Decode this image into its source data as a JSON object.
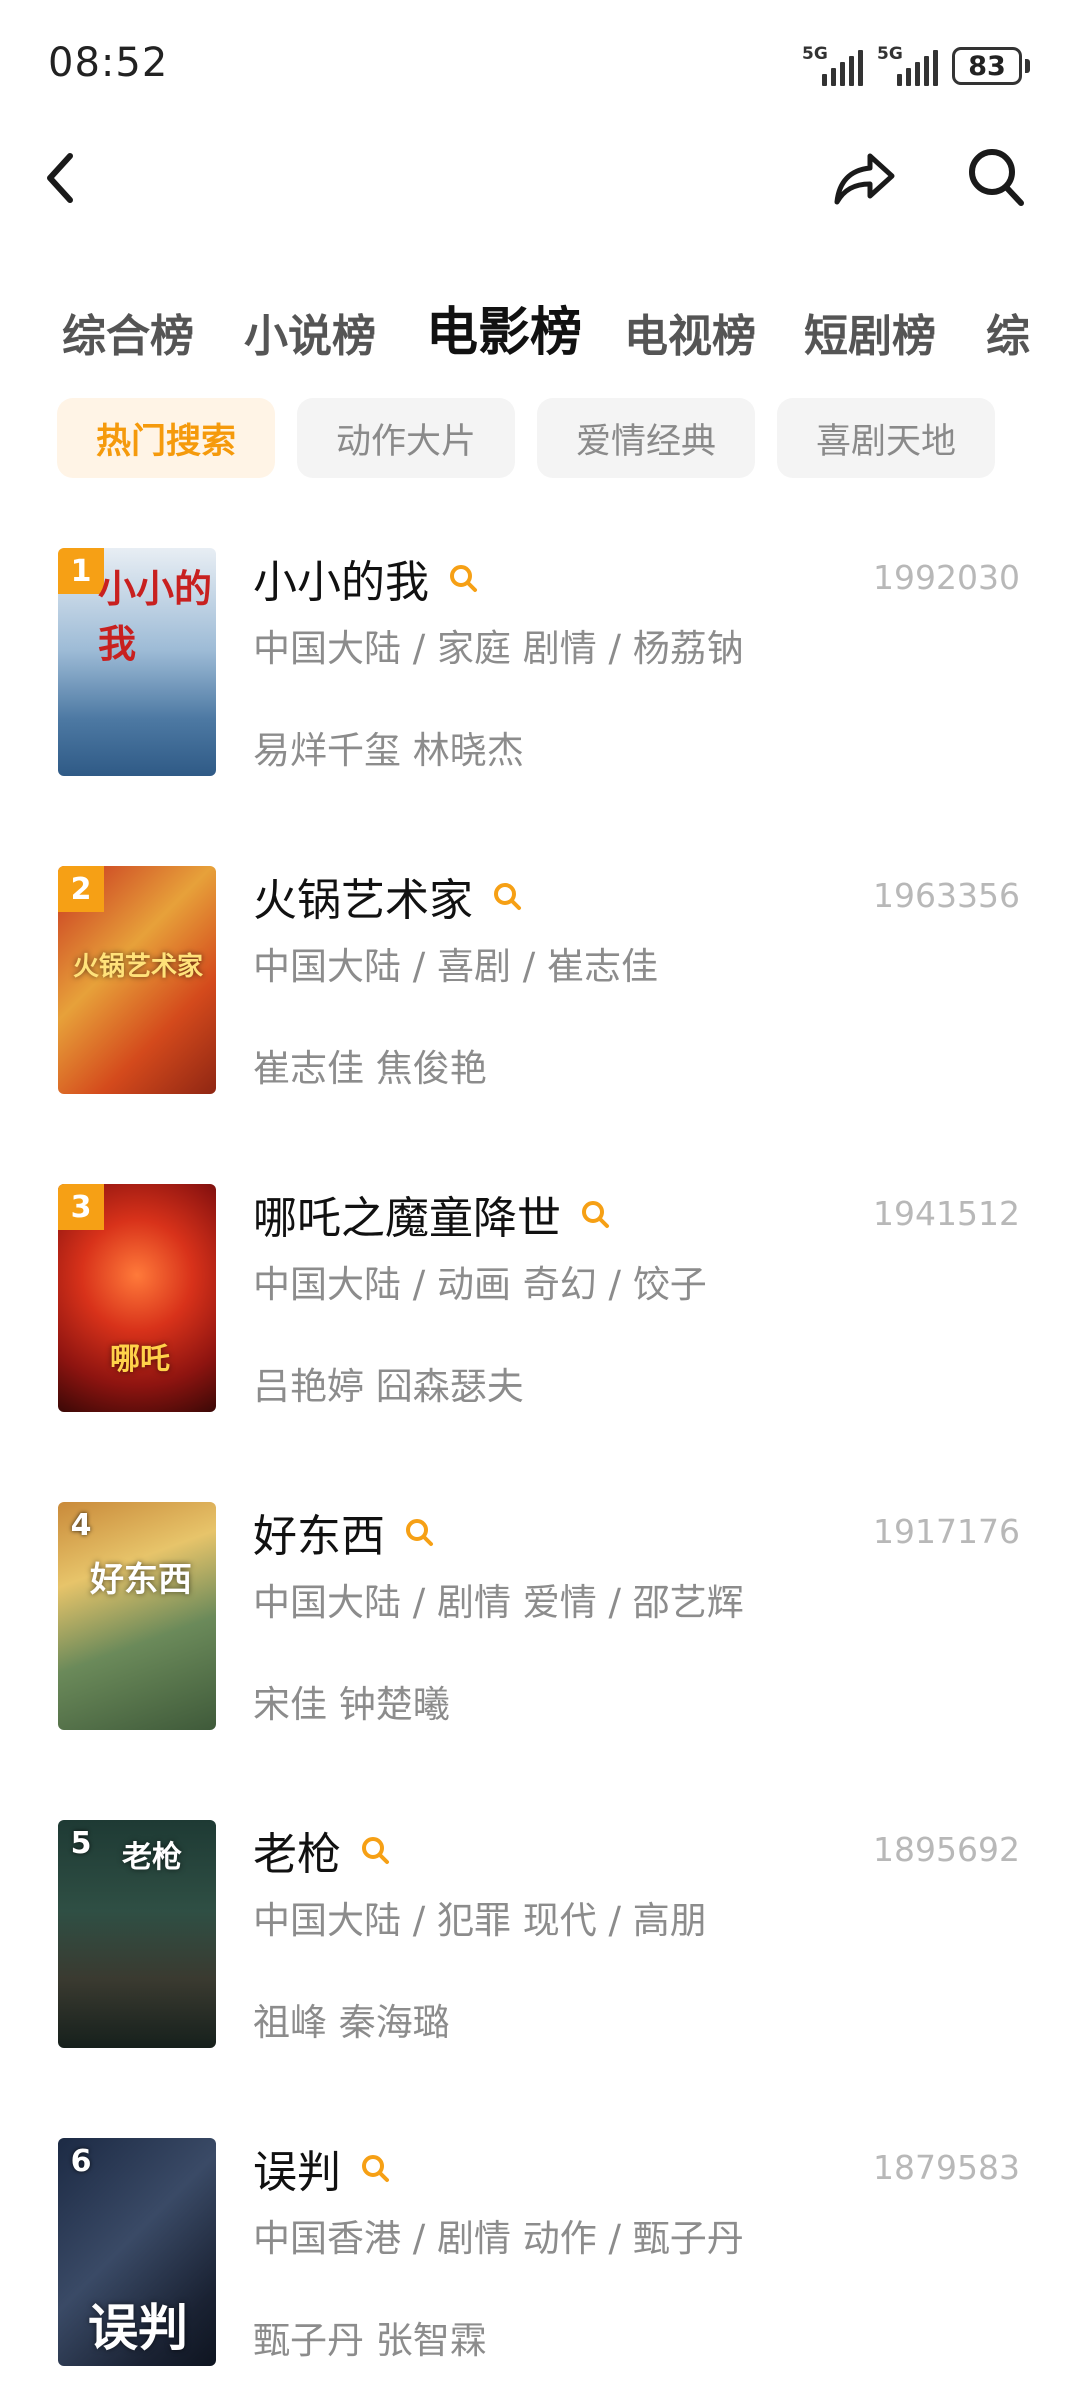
{
  "status_bar": {
    "time": "08:52",
    "signal_1_label": "5G",
    "signal_2_label": "5G",
    "battery_level": "83",
    "icons": [
      "signal-icon",
      "signal-icon",
      "battery-icon"
    ]
  },
  "nav": {
    "icons": [
      "back-chevron-icon",
      "share-icon",
      "search-icon"
    ]
  },
  "category_tabs": [
    {
      "label": "综合榜",
      "active": false
    },
    {
      "label": "小说榜",
      "active": false
    },
    {
      "label": "电影榜",
      "active": true
    },
    {
      "label": "电视榜",
      "active": false
    },
    {
      "label": "短剧榜",
      "active": false
    },
    {
      "label": "综",
      "active": false
    }
  ],
  "filter_chips": [
    {
      "label": "热门搜索",
      "active": true
    },
    {
      "label": "动作大片",
      "active": false
    },
    {
      "label": "爱情经典",
      "active": false
    },
    {
      "label": "喜剧天地",
      "active": false
    }
  ],
  "accent_color": "#F6A015",
  "movies": [
    {
      "rank": "1",
      "title": "小小的我",
      "count": "1992030",
      "meta": "中国大陆 / 家庭 剧情 / 杨荔钠",
      "actors": "易烊千玺 林晓杰",
      "poster_caption": "小小的我"
    },
    {
      "rank": "2",
      "title": "火锅艺术家",
      "count": "1963356",
      "meta": "中国大陆 / 喜剧 / 崔志佳",
      "actors": "崔志佳 焦俊艳",
      "poster_caption": "火锅艺术家"
    },
    {
      "rank": "3",
      "title": "哪吒之魔童降世",
      "count": "1941512",
      "meta": "中国大陆 / 动画 奇幻 / 饺子",
      "actors": "吕艳婷 囧森瑟夫",
      "poster_caption": "哪吒"
    },
    {
      "rank": "4",
      "title": "好东西",
      "count": "1917176",
      "meta": "中国大陆 / 剧情 爱情 / 邵艺辉",
      "actors": "宋佳 钟楚曦",
      "poster_caption": "好东西"
    },
    {
      "rank": "5",
      "title": "老枪",
      "count": "1895692",
      "meta": "中国大陆 / 犯罪 现代 / 高朋",
      "actors": "祖峰 秦海璐",
      "poster_caption": "老枪"
    },
    {
      "rank": "6",
      "title": "误判",
      "count": "1879583",
      "meta": "中国香港 / 剧情 动作 / 甄子丹",
      "actors": "甄子丹 张智霖",
      "poster_caption": "误判"
    }
  ]
}
